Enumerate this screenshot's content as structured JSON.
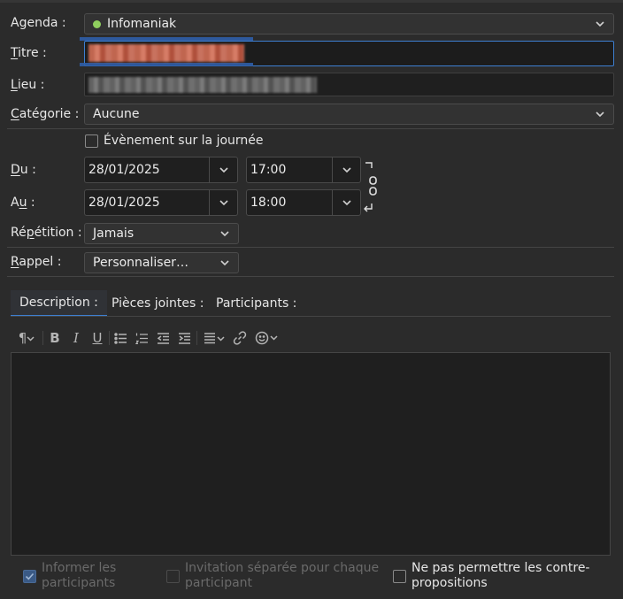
{
  "form": {
    "agenda": {
      "label": "Agenda :",
      "value": "Infomaniak",
      "status_color": "#8fcf5e"
    },
    "titre": {
      "label": "Titre :",
      "value": ""
    },
    "lieu": {
      "label": "Lieu :",
      "value": ""
    },
    "categorie": {
      "label": "Catégorie :",
      "value": "Aucune"
    },
    "allday": {
      "label": "Évènement sur la journée",
      "checked": false
    },
    "du": {
      "label": "Du :",
      "date": "28/01/2025",
      "time": "17:00"
    },
    "au": {
      "label": "Au :",
      "date": "28/01/2025",
      "time": "18:00"
    },
    "repetition": {
      "label": "Répétition :",
      "value": "Jamais"
    },
    "rappel": {
      "label": "Rappel :",
      "value": "Personnaliser…"
    }
  },
  "tabs": [
    {
      "label": "Description :",
      "active": true
    },
    {
      "label": "Pièces jointes :",
      "active": false
    },
    {
      "label": "Participants :",
      "active": false
    }
  ],
  "toolbar": [
    "paragraph-icon",
    "bold-icon",
    "italic-icon",
    "underline-icon",
    "bullet-list-icon",
    "numbered-list-icon",
    "outdent-icon",
    "indent-icon",
    "align-icon",
    "link-icon",
    "emoji-icon"
  ],
  "options": {
    "inform": {
      "label_1": "Informer les",
      "label_2": "participants",
      "checked": true,
      "enabled": false
    },
    "separate": {
      "label_1": "Invitation séparée pour chaque",
      "label_2": "participant",
      "checked": false,
      "enabled": false
    },
    "no_counter": {
      "label_1": "Ne pas permettre les contre-",
      "label_2": "propositions",
      "checked": false,
      "enabled": true
    }
  },
  "colors": {
    "accent": "#3d7fd1",
    "background": "#2b2b2b",
    "field": "#1f1f1f"
  }
}
